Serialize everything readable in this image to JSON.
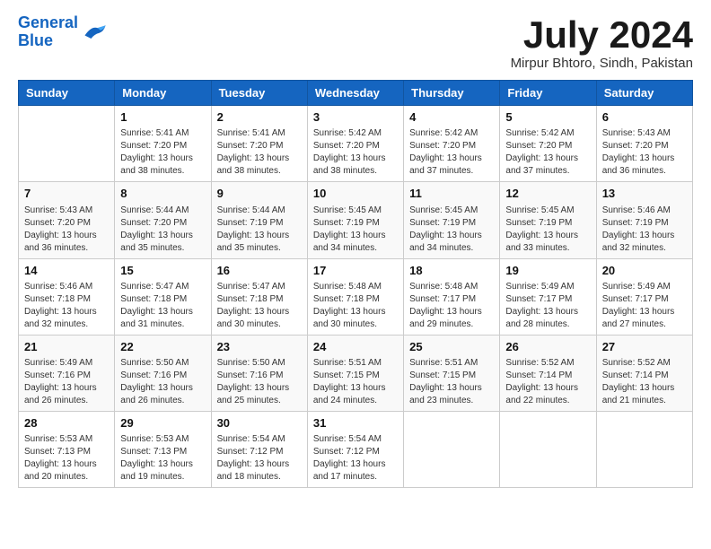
{
  "header": {
    "logo_line1": "General",
    "logo_line2": "Blue",
    "month_year": "July 2024",
    "location": "Mirpur Bhtoro, Sindh, Pakistan"
  },
  "weekdays": [
    "Sunday",
    "Monday",
    "Tuesday",
    "Wednesday",
    "Thursday",
    "Friday",
    "Saturday"
  ],
  "weeks": [
    [
      {
        "day": "",
        "sunrise": "",
        "sunset": "",
        "daylight": ""
      },
      {
        "day": "1",
        "sunrise": "Sunrise: 5:41 AM",
        "sunset": "Sunset: 7:20 PM",
        "daylight": "Daylight: 13 hours and 38 minutes."
      },
      {
        "day": "2",
        "sunrise": "Sunrise: 5:41 AM",
        "sunset": "Sunset: 7:20 PM",
        "daylight": "Daylight: 13 hours and 38 minutes."
      },
      {
        "day": "3",
        "sunrise": "Sunrise: 5:42 AM",
        "sunset": "Sunset: 7:20 PM",
        "daylight": "Daylight: 13 hours and 38 minutes."
      },
      {
        "day": "4",
        "sunrise": "Sunrise: 5:42 AM",
        "sunset": "Sunset: 7:20 PM",
        "daylight": "Daylight: 13 hours and 37 minutes."
      },
      {
        "day": "5",
        "sunrise": "Sunrise: 5:42 AM",
        "sunset": "Sunset: 7:20 PM",
        "daylight": "Daylight: 13 hours and 37 minutes."
      },
      {
        "day": "6",
        "sunrise": "Sunrise: 5:43 AM",
        "sunset": "Sunset: 7:20 PM",
        "daylight": "Daylight: 13 hours and 36 minutes."
      }
    ],
    [
      {
        "day": "7",
        "sunrise": "Sunrise: 5:43 AM",
        "sunset": "Sunset: 7:20 PM",
        "daylight": "Daylight: 13 hours and 36 minutes."
      },
      {
        "day": "8",
        "sunrise": "Sunrise: 5:44 AM",
        "sunset": "Sunset: 7:20 PM",
        "daylight": "Daylight: 13 hours and 35 minutes."
      },
      {
        "day": "9",
        "sunrise": "Sunrise: 5:44 AM",
        "sunset": "Sunset: 7:19 PM",
        "daylight": "Daylight: 13 hours and 35 minutes."
      },
      {
        "day": "10",
        "sunrise": "Sunrise: 5:45 AM",
        "sunset": "Sunset: 7:19 PM",
        "daylight": "Daylight: 13 hours and 34 minutes."
      },
      {
        "day": "11",
        "sunrise": "Sunrise: 5:45 AM",
        "sunset": "Sunset: 7:19 PM",
        "daylight": "Daylight: 13 hours and 34 minutes."
      },
      {
        "day": "12",
        "sunrise": "Sunrise: 5:45 AM",
        "sunset": "Sunset: 7:19 PM",
        "daylight": "Daylight: 13 hours and 33 minutes."
      },
      {
        "day": "13",
        "sunrise": "Sunrise: 5:46 AM",
        "sunset": "Sunset: 7:19 PM",
        "daylight": "Daylight: 13 hours and 32 minutes."
      }
    ],
    [
      {
        "day": "14",
        "sunrise": "Sunrise: 5:46 AM",
        "sunset": "Sunset: 7:18 PM",
        "daylight": "Daylight: 13 hours and 32 minutes."
      },
      {
        "day": "15",
        "sunrise": "Sunrise: 5:47 AM",
        "sunset": "Sunset: 7:18 PM",
        "daylight": "Daylight: 13 hours and 31 minutes."
      },
      {
        "day": "16",
        "sunrise": "Sunrise: 5:47 AM",
        "sunset": "Sunset: 7:18 PM",
        "daylight": "Daylight: 13 hours and 30 minutes."
      },
      {
        "day": "17",
        "sunrise": "Sunrise: 5:48 AM",
        "sunset": "Sunset: 7:18 PM",
        "daylight": "Daylight: 13 hours and 30 minutes."
      },
      {
        "day": "18",
        "sunrise": "Sunrise: 5:48 AM",
        "sunset": "Sunset: 7:17 PM",
        "daylight": "Daylight: 13 hours and 29 minutes."
      },
      {
        "day": "19",
        "sunrise": "Sunrise: 5:49 AM",
        "sunset": "Sunset: 7:17 PM",
        "daylight": "Daylight: 13 hours and 28 minutes."
      },
      {
        "day": "20",
        "sunrise": "Sunrise: 5:49 AM",
        "sunset": "Sunset: 7:17 PM",
        "daylight": "Daylight: 13 hours and 27 minutes."
      }
    ],
    [
      {
        "day": "21",
        "sunrise": "Sunrise: 5:49 AM",
        "sunset": "Sunset: 7:16 PM",
        "daylight": "Daylight: 13 hours and 26 minutes."
      },
      {
        "day": "22",
        "sunrise": "Sunrise: 5:50 AM",
        "sunset": "Sunset: 7:16 PM",
        "daylight": "Daylight: 13 hours and 26 minutes."
      },
      {
        "day": "23",
        "sunrise": "Sunrise: 5:50 AM",
        "sunset": "Sunset: 7:16 PM",
        "daylight": "Daylight: 13 hours and 25 minutes."
      },
      {
        "day": "24",
        "sunrise": "Sunrise: 5:51 AM",
        "sunset": "Sunset: 7:15 PM",
        "daylight": "Daylight: 13 hours and 24 minutes."
      },
      {
        "day": "25",
        "sunrise": "Sunrise: 5:51 AM",
        "sunset": "Sunset: 7:15 PM",
        "daylight": "Daylight: 13 hours and 23 minutes."
      },
      {
        "day": "26",
        "sunrise": "Sunrise: 5:52 AM",
        "sunset": "Sunset: 7:14 PM",
        "daylight": "Daylight: 13 hours and 22 minutes."
      },
      {
        "day": "27",
        "sunrise": "Sunrise: 5:52 AM",
        "sunset": "Sunset: 7:14 PM",
        "daylight": "Daylight: 13 hours and 21 minutes."
      }
    ],
    [
      {
        "day": "28",
        "sunrise": "Sunrise: 5:53 AM",
        "sunset": "Sunset: 7:13 PM",
        "daylight": "Daylight: 13 hours and 20 minutes."
      },
      {
        "day": "29",
        "sunrise": "Sunrise: 5:53 AM",
        "sunset": "Sunset: 7:13 PM",
        "daylight": "Daylight: 13 hours and 19 minutes."
      },
      {
        "day": "30",
        "sunrise": "Sunrise: 5:54 AM",
        "sunset": "Sunset: 7:12 PM",
        "daylight": "Daylight: 13 hours and 18 minutes."
      },
      {
        "day": "31",
        "sunrise": "Sunrise: 5:54 AM",
        "sunset": "Sunset: 7:12 PM",
        "daylight": "Daylight: 13 hours and 17 minutes."
      },
      {
        "day": "",
        "sunrise": "",
        "sunset": "",
        "daylight": ""
      },
      {
        "day": "",
        "sunrise": "",
        "sunset": "",
        "daylight": ""
      },
      {
        "day": "",
        "sunrise": "",
        "sunset": "",
        "daylight": ""
      }
    ]
  ]
}
